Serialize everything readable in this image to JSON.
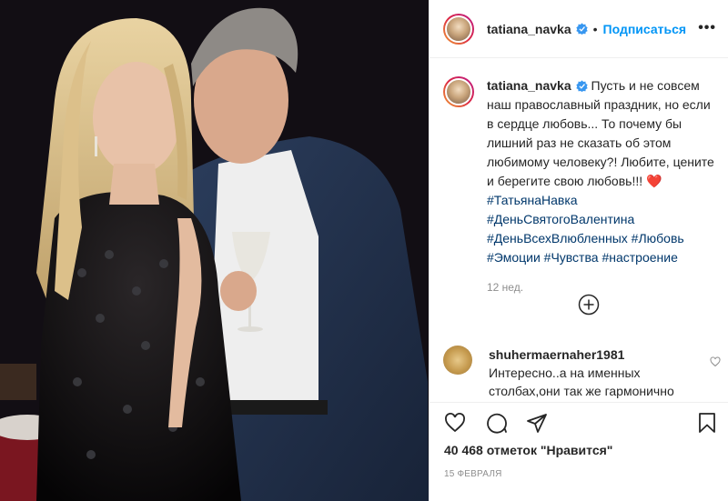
{
  "post": {
    "username": "tatiana_navka",
    "follow_label": "Подписаться",
    "more_icon": "•••",
    "caption_user": "tatiana_navka",
    "caption_text": "Пусть и не совсем наш православный праздник, но если в сердце любовь... То почему бы лишний раз не сказать об этом любимому человеку?! Любите, цените и берегите свою любовь!!!",
    "caption_emoji": "❤️",
    "hashtags": [
      "#ТатьянаНавка",
      "#ДеньСвятогоВалентина",
      "#ДеньВсехВлюбленных",
      "#Любовь",
      "#Эмоции",
      "#Чувства",
      "#настроение"
    ],
    "time_ago": "12 нед.",
    "comment_user": "shuhermaernaher1981",
    "comment_text": "Интересно..а на именных столбах,они так же гармонично",
    "likes": "40 468 отметок \"Нравится\"",
    "date": "15 ФЕВРАЛЯ"
  },
  "colors": {
    "accent": "#0095f6",
    "hashtag": "#00376b",
    "muted": "#8e8e8e",
    "border": "#efefef",
    "heart": "#e0245e"
  },
  "icons": [
    "verified-badge-icon",
    "more-options-icon",
    "load-more-comments-icon",
    "comment-like-icon",
    "like-icon",
    "comment-icon",
    "share-icon",
    "save-icon"
  ]
}
